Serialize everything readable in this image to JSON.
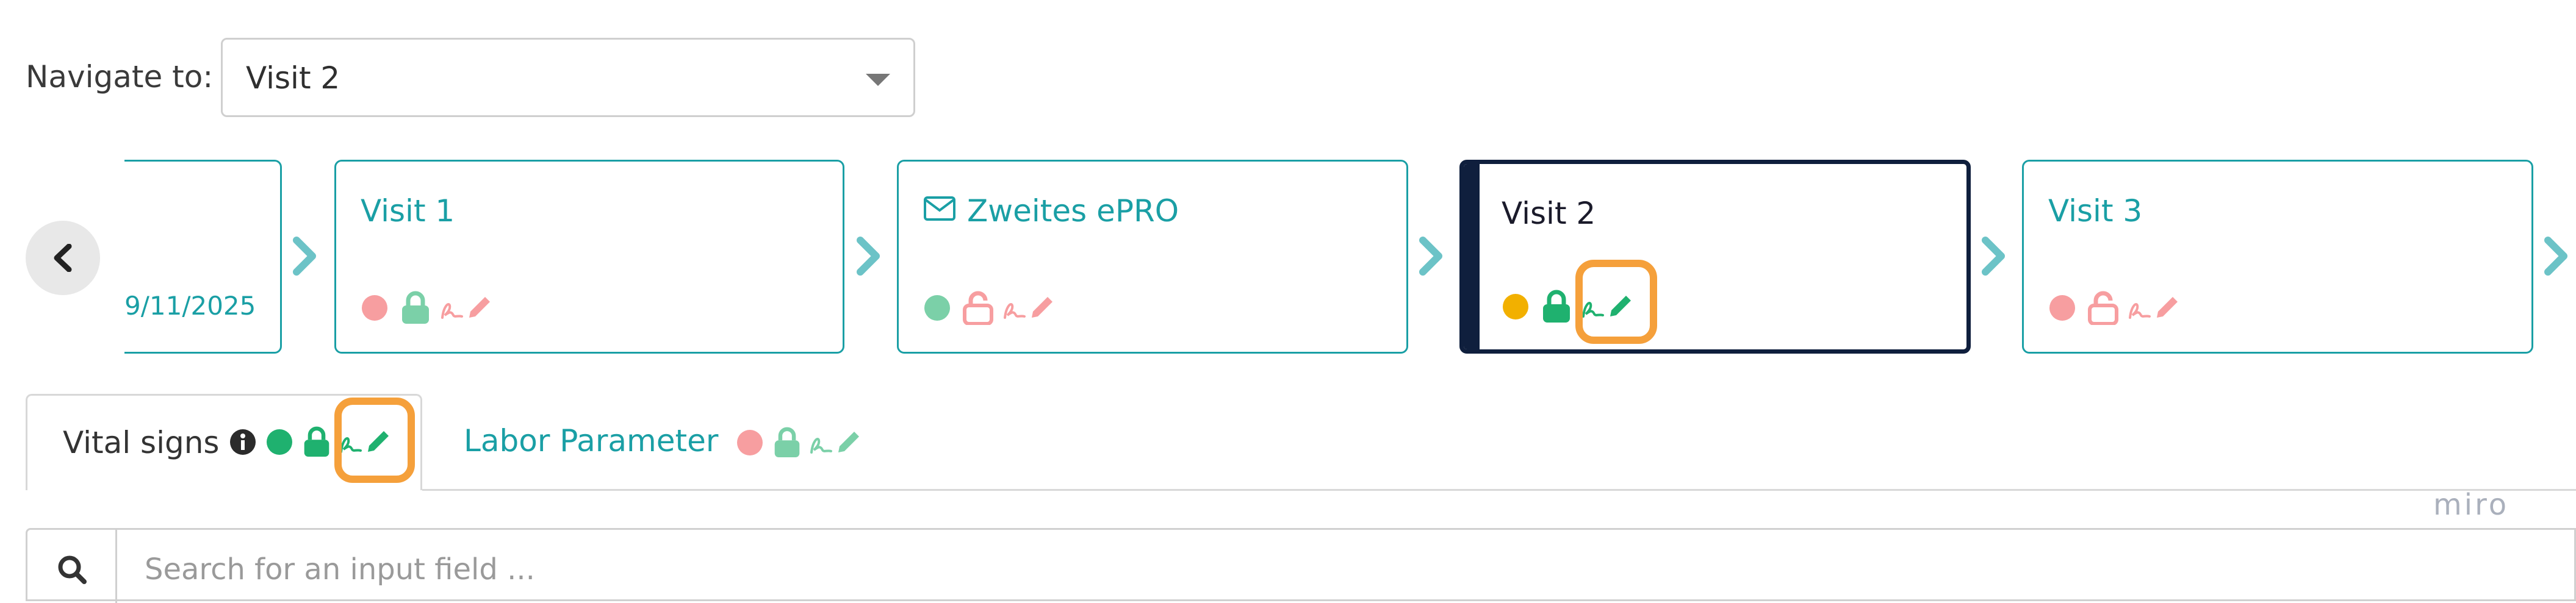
{
  "navigate": {
    "label": "Navigate to:",
    "selected": "Visit 2"
  },
  "timeline": {
    "prev_card_date": "9/11/2025",
    "cards": [
      {
        "title": "Visit 1"
      },
      {
        "title": "Zweites ePRO"
      },
      {
        "title": "Visit 2"
      },
      {
        "title": "Visit 3"
      }
    ]
  },
  "tabs": {
    "vital_signs": "Vital signs",
    "labor_parameter": "Labor Parameter"
  },
  "search": {
    "placeholder": "Search for an input field ..."
  },
  "watermark": "miro",
  "colors": {
    "teal": "#1a9fa5",
    "navy": "#0f1f3d",
    "status_red": "#f79ea0",
    "status_green": "#1fb16f",
    "status_yellow": "#f2b000",
    "highlight_orange": "#f5a03b"
  }
}
